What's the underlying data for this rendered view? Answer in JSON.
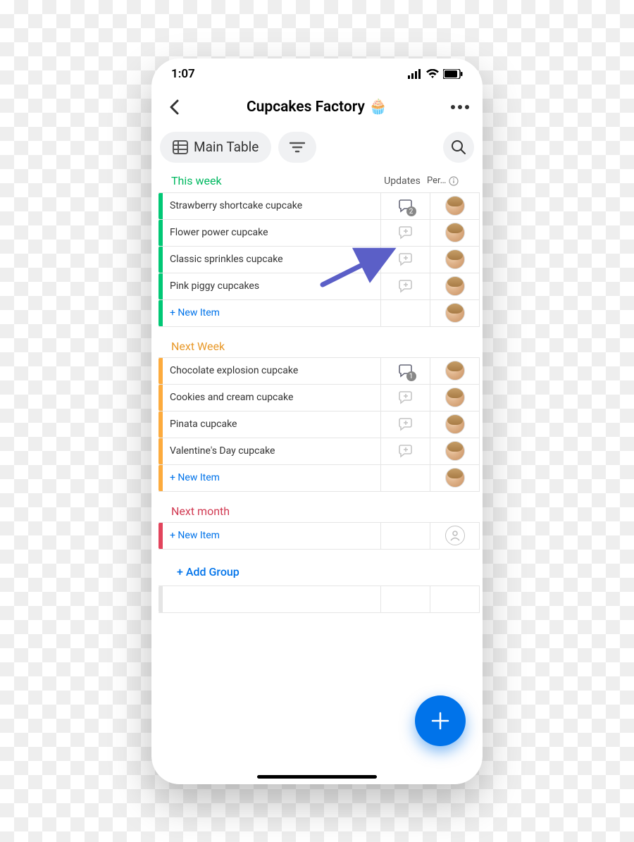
{
  "status": {
    "time": "1:07"
  },
  "header": {
    "title": "Cupcakes Factory",
    "emoji": "🧁"
  },
  "toolbar": {
    "view_label": "Main Table"
  },
  "columns": {
    "updates": "Updates",
    "person": "Per…"
  },
  "groups": [
    {
      "name": "This week",
      "color": "#00c875",
      "title_color": "#00b860",
      "items": [
        {
          "name": "Strawberry shortcake cupcake",
          "updates": 2,
          "person": "user"
        },
        {
          "name": "Flower power cupcake",
          "updates": null,
          "person": "user"
        },
        {
          "name": "Classic sprinkles cupcake",
          "updates": null,
          "person": "user"
        },
        {
          "name": "Pink piggy cupcakes",
          "updates": null,
          "person": "user"
        }
      ],
      "new_item_label": "+ New Item",
      "new_item_person": "user"
    },
    {
      "name": "Next Week",
      "color": "#fdab3d",
      "title_color": "#e8992a",
      "items": [
        {
          "name": "Chocolate explosion cupcake",
          "updates": 1,
          "person": "user"
        },
        {
          "name": "Cookies and cream cupcake",
          "updates": null,
          "person": "user"
        },
        {
          "name": "Pinata cupcake",
          "updates": null,
          "person": "user"
        },
        {
          "name": "Valentine's Day cupcake",
          "updates": null,
          "person": "user"
        }
      ],
      "new_item_label": "+ New Item",
      "new_item_person": "user"
    },
    {
      "name": "Next month",
      "color": "#e2445c",
      "title_color": "#d13a52",
      "items": [],
      "new_item_label": "+ New Item",
      "new_item_person": "empty"
    }
  ],
  "add_group_label": "+ Add Group",
  "annotation": {
    "arrow_color": "#5b5fc7"
  }
}
